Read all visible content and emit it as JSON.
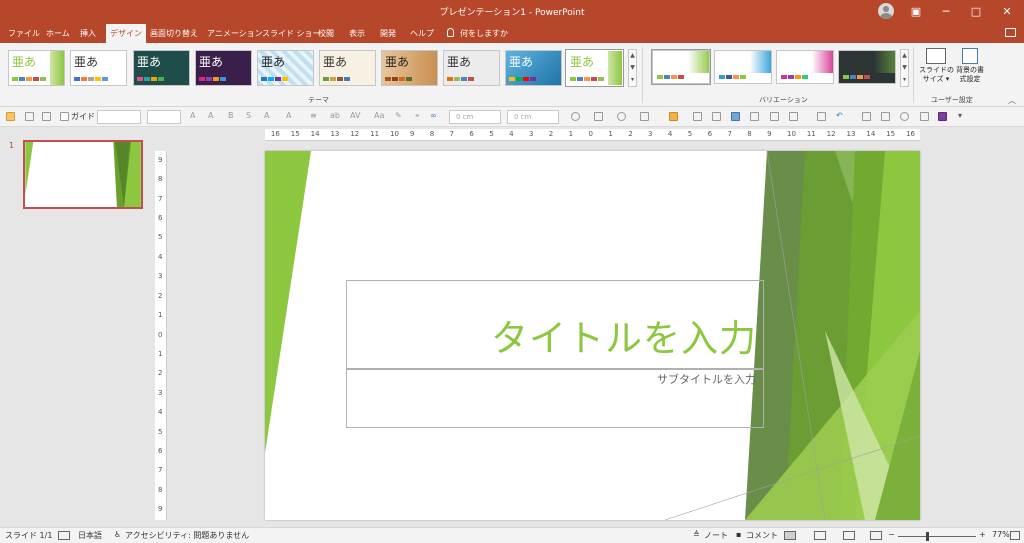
{
  "window": {
    "title": "プレゼンテーション1  -  PowerPoint",
    "minimize": "─",
    "maximize": "□",
    "close": "✕"
  },
  "tabs": [
    "ファイル",
    "ホーム",
    "挿入",
    "デザイン",
    "画面切り替え",
    "アニメーション",
    "スライド ショー",
    "校閲",
    "表示",
    "開発",
    "ヘルプ",
    "何をしますか"
  ],
  "active_tab": "デザイン",
  "ribbon": {
    "themes_label": "テーマ",
    "variations_label": "バリエーション",
    "custom_label": "ユーザー設定",
    "theme_glyphs": [
      "亜あ",
      "亜あ",
      "亜あ",
      "亜あ",
      "亜あ",
      "亜あ",
      "亜あ",
      "亜あ",
      "亜あ",
      "亜あ"
    ],
    "slide_size": "スライドの\nサイズ ▾",
    "bg_format": "背景の書\n式設定",
    "collapse_icon": "chevron-up-icon",
    "colors": {
      "accent": "#b7472a",
      "facet_green": "#8dc63f"
    }
  },
  "qat": {
    "guide": "ガイド",
    "width_placeholder": "0 cm",
    "height_placeholder": "0 cm"
  },
  "slides_panel": {
    "number": "1"
  },
  "ruler": {
    "h_ticks": [
      "16",
      "15",
      "14",
      "13",
      "12",
      "11",
      "10",
      "9",
      "8",
      "7",
      "6",
      "5",
      "4",
      "3",
      "2",
      "1",
      "0",
      "1",
      "2",
      "3",
      "4",
      "5",
      "6",
      "7",
      "8",
      "9",
      "10",
      "11",
      "12",
      "13",
      "14",
      "15",
      "16"
    ],
    "v_ticks": [
      "9",
      "8",
      "7",
      "6",
      "5",
      "4",
      "3",
      "2",
      "1",
      "0",
      "1",
      "2",
      "3",
      "4",
      "5",
      "6",
      "7",
      "8",
      "9"
    ]
  },
  "slide": {
    "title": "タイトルを入力",
    "subtitle": "サブタイトルを入力"
  },
  "status": {
    "slide": "スライド 1/1",
    "language": "日本語",
    "accessibility": "アクセシビリティ: 問題ありません",
    "notes": "ノート",
    "comments": "コメント",
    "zoom": "77%",
    "zoom_minus": "−",
    "zoom_plus": "+"
  }
}
